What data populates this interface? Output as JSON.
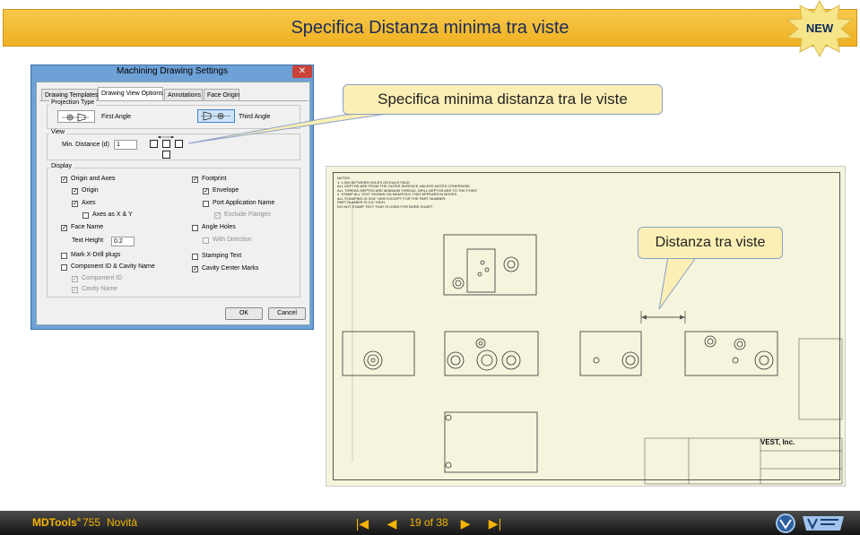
{
  "banner": {
    "title": "Specifica Distanza minima tra viste",
    "badge": "NEW"
  },
  "dialog": {
    "title": "Machining Drawing Settings",
    "close": "✕",
    "tabs": [
      "Drawing Templates",
      "Drawing View Options",
      "Annotations",
      "Face Origin"
    ],
    "active_tab": "Drawing View Options",
    "projection": {
      "group": "Projection Type",
      "first": "First Angle",
      "third": "Third Angle",
      "selected": "Third Angle"
    },
    "view": {
      "group": "View",
      "min_distance_label": "Min. Distance (d)",
      "min_distance_value": "1"
    },
    "display": {
      "group": "Display",
      "left": [
        {
          "label": "Origin and Axes",
          "checked": true,
          "enabled": true
        },
        {
          "label": "Origin",
          "checked": true,
          "enabled": true
        },
        {
          "label": "Axes",
          "checked": true,
          "enabled": true
        },
        {
          "label": "Axes as X & Y",
          "checked": false,
          "enabled": true
        },
        {
          "label": "Face Name",
          "checked": true,
          "enabled": true
        },
        {
          "label": "Mark X-Drill plugs",
          "checked": false,
          "enabled": true
        },
        {
          "label": "Component ID & Cavity Name",
          "checked": false,
          "enabled": true
        },
        {
          "label": "Component ID",
          "checked": true,
          "enabled": false
        },
        {
          "label": "Cavity Name",
          "checked": true,
          "enabled": false
        }
      ],
      "text_height_label": "Text Height",
      "text_height_value": "0.2",
      "right": [
        {
          "label": "Footprint",
          "checked": true,
          "enabled": true
        },
        {
          "label": "Envelope",
          "checked": true,
          "enabled": true
        },
        {
          "label": "Port Application Name",
          "checked": false,
          "enabled": true
        },
        {
          "label": "Exclude Flanges",
          "checked": true,
          "enabled": false
        },
        {
          "label": "Angle Holes",
          "checked": false,
          "enabled": true
        },
        {
          "label": "With Direction",
          "checked": false,
          "enabled": false
        },
        {
          "label": "Stamping Text",
          "checked": false,
          "enabled": true
        },
        {
          "label": "Cavity Center Marks",
          "checked": true,
          "enabled": true
        }
      ]
    },
    "ok": "OK",
    "cancel": "Cancel"
  },
  "callout_top": "Specifica minima distanza tra le viste",
  "callout_drawing": "Distanza tra viste",
  "drawing": {
    "notes": [
      "NOTES:",
      "1. ±.005 BETWEEN HOLES ON EACH FACE.",
      "   ALL DEPTHS ARE FROM THE OUTER SURFACE UNLESS NOTED OTHERWISE.",
      "   ALL THREAD DEPTHS ARE MINIMUM THREAD, DRILL DEPTHS ARE TO THE POINT.",
      "2. STAMP ALL TEXT SHOWN ON MANIFOLD THAT APPEARS IN BOXES.",
      "   ALL STAMPING IS 3/16\" HIGH EXCEPT FOR THE PART NUMBER.",
      "   PART NUMBER IS 1/4\" HIGH.",
      "   DO NOT STAMP TEXT THAT IS USED FOR BORE CHART."
    ],
    "company": "VEST, Inc."
  },
  "footer": {
    "product": "MDTools",
    "registered": "®",
    "version": "755",
    "section": "Novità",
    "page": "19 of 38",
    "nav": {
      "first": "|◀",
      "prev": "◀",
      "next": "▶",
      "last": "▶|"
    }
  }
}
